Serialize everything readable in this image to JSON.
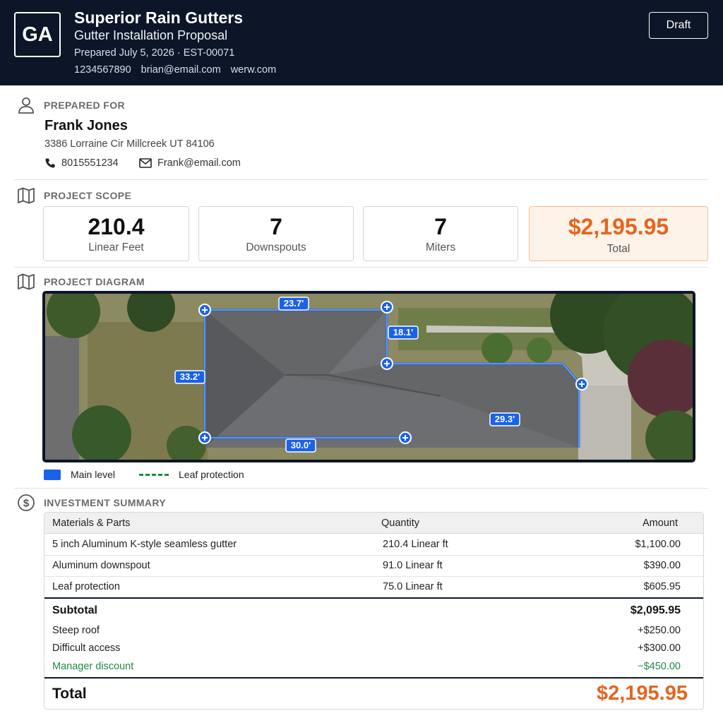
{
  "header": {
    "logo_text": "GA",
    "company": "Superior Rain Gutters",
    "doc_title": "Gutter Installation Proposal",
    "prepared": "Prepared July 5, 2026 · EST-00071",
    "phone": "1234567890",
    "email": "brian@email.com",
    "website": "werw.com",
    "status_button": "Draft"
  },
  "client": {
    "section_label": "PREPARED FOR",
    "name": "Frank Jones",
    "address": "3386 Lorraine Cir Millcreek UT 84106",
    "phone": "8015551234",
    "email": "Frank@email.com"
  },
  "scope": {
    "section_label": "PROJECT SCOPE",
    "stats": [
      {
        "value": "210.4",
        "label": "Linear Feet"
      },
      {
        "value": "7",
        "label": "Downspouts"
      },
      {
        "value": "7",
        "label": "Miters"
      },
      {
        "value": "$2,195.95",
        "label": "Total"
      }
    ]
  },
  "diagram": {
    "section_label": "PROJECT DIAGRAM",
    "measurements": [
      "23.7'",
      "18.1'",
      "33.2'",
      "29.3'",
      "30.0'"
    ],
    "legend": {
      "main": "Main level",
      "leaf": "Leaf protection"
    },
    "colors": {
      "line": "#1a62e8",
      "leaf": "#1f8a44"
    }
  },
  "investment": {
    "section_label": "INVESTMENT SUMMARY",
    "columns": [
      "Materials & Parts",
      "Quantity",
      "Amount"
    ],
    "rows": [
      [
        "5 inch Aluminum K-style seamless gutter",
        "210.4 Linear ft",
        "$1,100.00"
      ],
      [
        "Aluminum downspout",
        "91.0 Linear ft",
        "$390.00"
      ],
      [
        "Leaf protection",
        "75.0 Linear ft",
        "$605.95"
      ]
    ],
    "subtotal_label": "Subtotal",
    "subtotal_value": "$2,095.95",
    "adjustments": [
      {
        "label": "Steep roof",
        "value": "+$250.00"
      },
      {
        "label": "Difficult access",
        "value": "+$300.00"
      },
      {
        "label": "Manager discount",
        "value": "−$450.00"
      }
    ],
    "total_label": "Total",
    "total_value": "$2,195.95"
  },
  "theme": {
    "navy": "#0c1628",
    "accent_orange": "#e5651f",
    "accent_green": "#1f8a44",
    "accent_blue": "#1a62e8"
  }
}
